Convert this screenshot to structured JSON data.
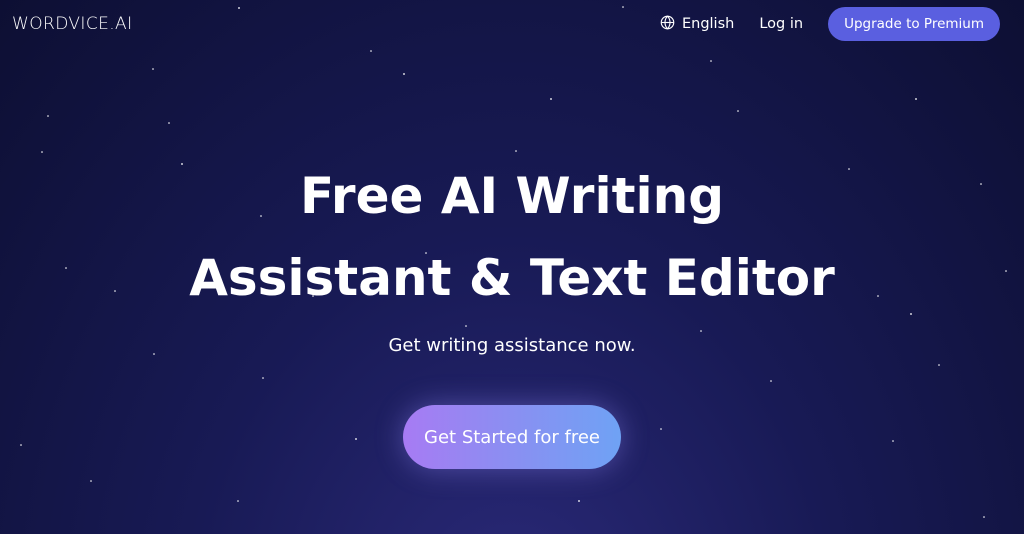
{
  "header": {
    "logo": "WORDVICE.AI",
    "language_label": "English",
    "login_label": "Log in",
    "premium_label": "Upgrade to Premium"
  },
  "hero": {
    "title_line1": "Free AI Writing",
    "title_line2": "Assistant & Text Editor",
    "subtitle": "Get writing assistance now.",
    "cta_label": "Get Started for free"
  },
  "colors": {
    "background": "#181a55",
    "premium_button": "#5a5fe0",
    "cta_gradient_start": "#a77bf3",
    "cta_gradient_end": "#6fa2f4"
  },
  "icons": {
    "language": "globe-icon"
  }
}
